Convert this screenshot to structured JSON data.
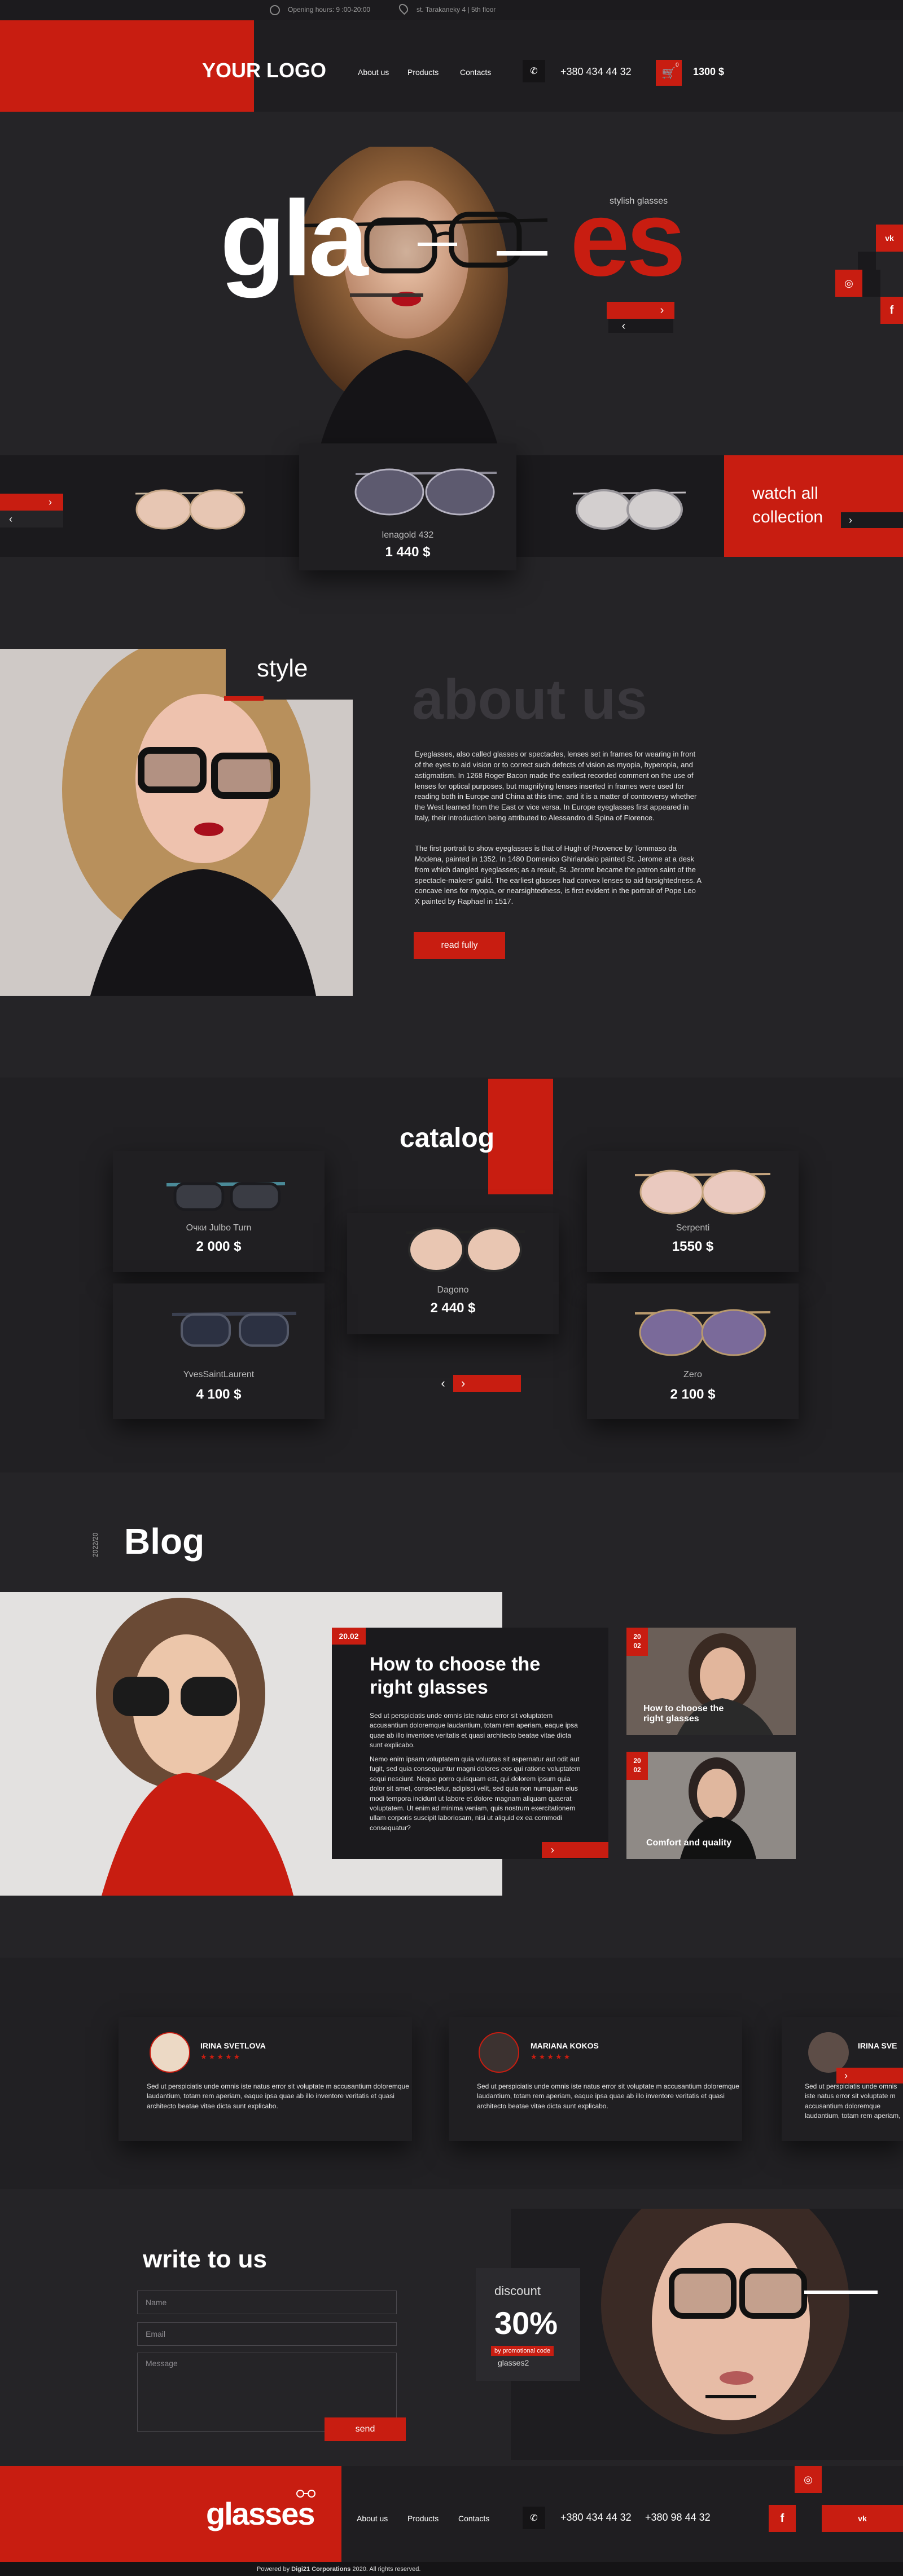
{
  "topbar": {
    "hours": "Opening hours: 9 :00-20:00",
    "address": "st. Tarakaneky 4 | 5th floor"
  },
  "header": {
    "logo": "YOUR LOGO",
    "nav": [
      "About us",
      "Products",
      "Contacts"
    ],
    "phone": "+380 434 44 32",
    "cart_count": "0",
    "cart_total": "1300 $"
  },
  "hero": {
    "title_left": "gla",
    "title_right": "es",
    "tagline": "stylish glasses",
    "social": [
      "vk-icon",
      "instagram-icon",
      "facebook-icon"
    ]
  },
  "carousel": {
    "featured_name": "lenagold 432",
    "featured_price": "1 440 $",
    "watch_all": "watch all",
    "collection": "collection"
  },
  "about": {
    "style_label": "style",
    "ghost_title": "about us",
    "p1": "Eyeglasses, also called glasses or spectacles, lenses set in frames for wearing in front of the eyes to aid vision or to correct such defects of vision as myopia, hyperopia, and astigmatism. In 1268 Roger Bacon made the earliest recorded comment on the use of lenses for optical purposes, but magnifying lenses inserted in frames were used for reading both in Europe and China at this time, and it is a matter of controversy whether the West learned from the East or vice versa. In Europe eyeglasses first appeared in Italy, their introduction being attributed to Alessandro di Spina of Florence.",
    "p2": "The first portrait to show eyeglasses is that of Hugh of Provence by Tommaso da Modena, painted in 1352. In 1480 Domenico Ghirlandaio painted St. Jerome at a desk from which dangled eyeglasses; as a result, St. Jerome became the patron saint of the spectacle-makers' guild. The earliest glasses had convex lenses to aid farsightedness. A concave lens for myopia, or nearsightedness, is first evident in the portrait of Pope Leo X painted by Raphael in 1517.",
    "button": "read fully"
  },
  "catalog": {
    "title": "catalog",
    "items": [
      {
        "name": "Очки Julbo Turn",
        "price": "2 000 $"
      },
      {
        "name": "Dagonо",
        "price": "2 440 $"
      },
      {
        "name": "Serpenti",
        "price": "1550 $"
      },
      {
        "name": "YvesSaintLaurent",
        "price": "4 100 $"
      },
      {
        "name": "Zero",
        "price": "2 100 $"
      }
    ]
  },
  "blog": {
    "year": "2022/20",
    "title": "Blog",
    "date": "20.02",
    "post_title": "How to choose the right glasses",
    "post_p1": "Sed ut perspiciatis unde omnis iste natus error sit voluptatem accusantium doloremque laudantium, totam rem aperiam, eaque ipsa quae ab illo inventore veritatis et quasi architecto beatae vitae dicta sunt explicabo.",
    "post_p2": "Nemo enim ipsam voluptatem quia voluptas sit aspernatur aut odit aut fugit, sed quia consequuntur magni dolores eos qui ratione voluptatem sequi nesciunt. Neque porro quisquam est, qui dolorem ipsum quia dolor sit amet, consectetur, adipisci velit, sed quia non numquam eius modi tempora incidunt ut labore et dolore magnam aliquam quaerat voluptatem. Ut enim ad minima veniam, quis nostrum exercitationem ullam corporis suscipit laboriosam, nisi ut aliquid ex ea commodi consequatur?",
    "side": [
      {
        "date_day": "20",
        "date_month": "02",
        "title": "How to choose the right glasses"
      },
      {
        "date_day": "20",
        "date_month": "02",
        "title": "Comfort and quality"
      }
    ]
  },
  "reviews": [
    {
      "name": "IRINA SVETLOVA",
      "stars": "★★★★★",
      "text": "Sed ut perspiciatis unde omnis iste natus error sit voluptate m accusantium doloremque laudantium, totam rem aperiam, eaque ipsa quae ab illo inventore veritatis et quasi architecto beatae vitae dicta sunt explicabo."
    },
    {
      "name": "MARIANA KOKOS",
      "stars": "★★★★★",
      "text": "Sed ut perspiciatis unde omnis iste natus error sit voluptate m accusantium doloremque laudantium, totam rem aperiam, eaque ipsa quae ab illo inventore veritatis et quasi architecto beatae vitae dicta sunt explicabo."
    },
    {
      "name": "IRINA SVE",
      "stars": "",
      "text": "Sed ut perspiciatis unde omnis iste natus error sit voluptate m accusantium doloremque laudantium, totam rem aperiam, eaque ipsa quae ab illo inventore veritatis et quasi architecto beatae vitae dicta sunt explicabo."
    }
  ],
  "contact": {
    "title": "write to us",
    "name_ph": "Name",
    "email_ph": "Email",
    "message_ph": "Message",
    "send": "send",
    "discount_label": "discount",
    "discount_value": "30%",
    "promo_label": "by promotional code",
    "promo_code": "glasses2"
  },
  "footer": {
    "logo": "glasses",
    "nav": [
      "About us",
      "Products",
      "Contacts"
    ],
    "phone1": "+380 434 44 32",
    "phone2": "+380 98 44 32",
    "copyright_pre": "Powered by ",
    "copyright_brand": "Digi21 Corporations",
    "copyright_post": " 2020. All rights reserved."
  },
  "colors": {
    "accent": "#c81d11",
    "background": "#252427",
    "card": "#201f22"
  }
}
